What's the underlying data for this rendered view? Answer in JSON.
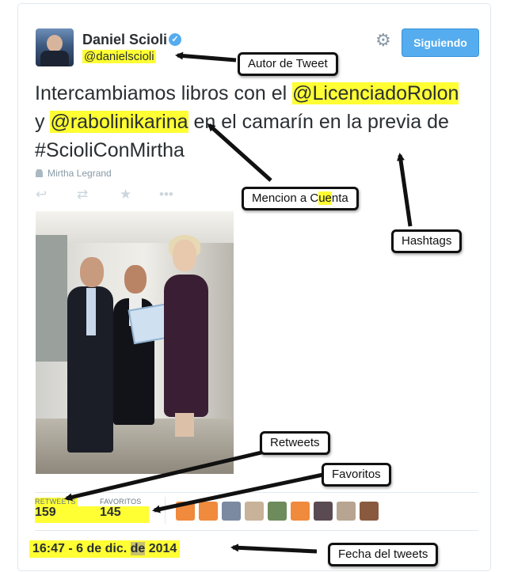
{
  "author": {
    "name": "Daniel Scioli",
    "handle": "@danielscioli",
    "verified_mark": "✓"
  },
  "follow_button": {
    "label": "Siguiendo"
  },
  "tweet": {
    "parts": [
      "Intercambiamos libros con el ",
      "@LicenciadoRolon",
      " y ",
      "@rabolinikarina",
      " en el camarín en la previa de #ScioliConMirtha"
    ]
  },
  "context": {
    "tagged": "Mirtha Legrand"
  },
  "actions": [
    "reply-icon",
    "retweet-icon",
    "favorite-icon",
    "more-icon"
  ],
  "stats": {
    "retweets_label": "RETWEETS",
    "retweets_value": "159",
    "favorites_label": "FAVORITOS",
    "favorites_value": "145"
  },
  "favoriters_avatar_colors": [
    "#f08a3c",
    "#f08a3c",
    "#7b8aa1",
    "#c9b29a",
    "#6e8b5c",
    "#f08a3c",
    "#5a4a52",
    "#b7a591",
    "#8a5a3f"
  ],
  "date": {
    "prefix": "16:47 - 6 de dic. ",
    "dim": "de",
    "suffix": " 2014"
  },
  "annotations": {
    "autor": "Autor de Tweet",
    "mencion_prefix": "Mencion a C",
    "mencion_dim": "ue",
    "mencion_suffix": "nta",
    "hashtags": "Hashtags",
    "retweets": "Retweets",
    "favoritos": "Favoritos",
    "fecha": "Fecha del tweets"
  },
  "colors": {
    "highlight": "#ffff33",
    "accent": "#55acee",
    "text": "#292f33",
    "muted": "#8899a6"
  }
}
